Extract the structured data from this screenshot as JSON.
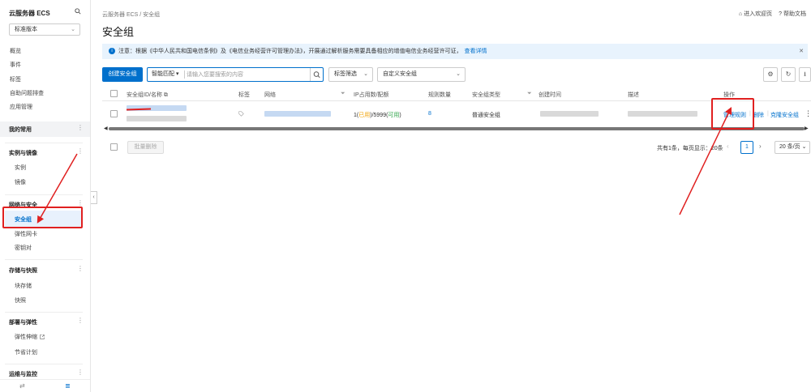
{
  "sidebar": {
    "title": "云服务器 ECS",
    "version_select": "标准版本",
    "top_items": [
      "概览",
      "事件",
      "标签",
      "自助问题排查",
      "应用管理"
    ],
    "favorites": "我的常用",
    "groups": {
      "instances": {
        "label": "实例与镜像",
        "items": [
          "实例",
          "镜像"
        ]
      },
      "network": {
        "label": "网络与安全",
        "items": [
          "安全组",
          "弹性网卡",
          "密钥对"
        ]
      },
      "storage": {
        "label": "存储与快照",
        "items": [
          "块存储",
          "快照"
        ]
      },
      "deploy": {
        "label": "部署与弹性",
        "items": [
          "弹性伸缩",
          "节省计划"
        ]
      },
      "ops": {
        "label": "运维与监控"
      }
    }
  },
  "header": {
    "breadcrumb": "云服务器 ECS  /  安全组",
    "title": "安全组",
    "link_welcome": "进入欢迎页",
    "link_help": "帮助文档"
  },
  "notice": {
    "text": "注意：根据《中华人民共和国电信条例》及《电信业务经营许可管理办法》，开展通过解析服务需要具备相应的增值电信业务经营许可证，",
    "link": "查看详情"
  },
  "toolbar": {
    "create_label": "创建安全组",
    "search_mode": "智能匹配",
    "search_placeholder": "请输入您要搜索的内容",
    "tag_filter": "标签筛选",
    "custom_group": "自定义安全组"
  },
  "table": {
    "headers": {
      "id_name": "安全组ID/名称",
      "tag": "标签",
      "network": "网络",
      "ip_usage": "IP占用数/配额",
      "rule_count": "规则数量",
      "type": "安全组类型",
      "created": "创建时间",
      "description": "描述",
      "actions": "操作"
    },
    "row": {
      "ip_used_prefix": "1(",
      "ip_used_word": "已用",
      "ip_mid": ")/5999(",
      "ip_avail_word": "可用",
      "ip_suffix": ")",
      "rule_count": "8",
      "type": "普通安全组",
      "action_manage": "管理规则",
      "action_delete": "删除",
      "action_clone": "克隆安全组"
    }
  },
  "footer": {
    "batch_delete": "批量删除",
    "pagination_text": "共有1条，每页显示：20条",
    "current_page": "1",
    "page_size": "20 条/页"
  },
  "colors": {
    "primary": "#0070cc",
    "annotation_red": "#e02020",
    "used_orange": "#f0a000",
    "available_green": "#2ba245"
  }
}
